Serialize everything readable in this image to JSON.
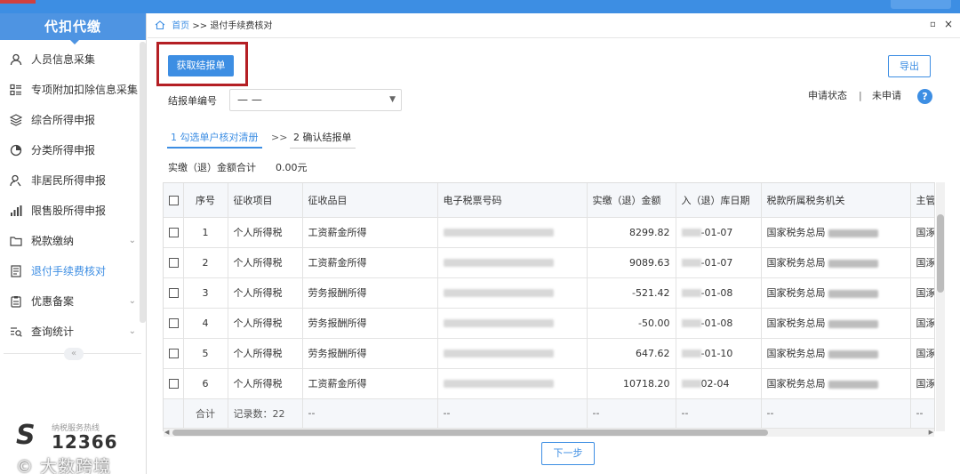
{
  "topbar": {
    "title": ""
  },
  "sidebar": {
    "title": "代扣代缴",
    "items": [
      {
        "label": "人员信息采集",
        "icon": "person-icon",
        "chevron": ""
      },
      {
        "label": "专项附加扣除信息采集",
        "icon": "list-icon",
        "chevron": ""
      },
      {
        "label": "综合所得申报",
        "icon": "layers-icon",
        "chevron": ""
      },
      {
        "label": "分类所得申报",
        "icon": "pie-icon",
        "chevron": ""
      },
      {
        "label": "非居民所得申报",
        "icon": "person-outline-icon",
        "chevron": ""
      },
      {
        "label": "限售股所得申报",
        "icon": "bar-chart-icon",
        "chevron": ""
      },
      {
        "label": "税款缴纳",
        "icon": "folder-icon",
        "chevron": "⌄"
      },
      {
        "label": "退付手续费核对",
        "icon": "document-icon",
        "chevron": "",
        "active": true
      },
      {
        "label": "优惠备案",
        "icon": "clipboard-icon",
        "chevron": "⌄"
      },
      {
        "label": "查询统计",
        "icon": "search-list-icon",
        "chevron": "⌄"
      }
    ],
    "collapse_glyph": "«",
    "hotline_label": "纳税服务热线",
    "hotline_number": "12366",
    "watermark": "© 大数跨境"
  },
  "breadcrumb": {
    "home": "首页",
    "sep": ">>",
    "current": "退付手续费核对"
  },
  "window_controls": {
    "restore": "▫",
    "close": "×"
  },
  "actions": {
    "fetch_label": "获取结报单",
    "export_label": "导出",
    "next_label": "下一步"
  },
  "filter": {
    "label": "结报单编号",
    "value": "— —"
  },
  "status": {
    "label": "申请状态",
    "sep": "|",
    "value": "未申请",
    "help": "?"
  },
  "steps": [
    {
      "label": "1 勾选单户核对清册",
      "active": true
    },
    {
      "label": "2 确认结报单",
      "active": false
    }
  ],
  "step_sep": ">>",
  "summary": {
    "label": "实缴（退）金额合计",
    "value": "0.00元"
  },
  "table": {
    "columns": [
      "序号",
      "征收项目",
      "征收品目",
      "电子税票号码",
      "实缴（退）金额",
      "入（退）库日期",
      "税款所属税务机关",
      "主管"
    ],
    "rows": [
      {
        "no": "1",
        "item": "个人所得税",
        "category": "工资薪金所得",
        "amount": "8299.82",
        "date": "-01-07",
        "office": "国家税务总局",
        "tail": "国涿"
      },
      {
        "no": "2",
        "item": "个人所得税",
        "category": "工资薪金所得",
        "amount": "9089.63",
        "date": "-01-07",
        "office": "国家税务总局",
        "tail": "国涿"
      },
      {
        "no": "3",
        "item": "个人所得税",
        "category": "劳务报酬所得",
        "amount": "-521.42",
        "date": "-01-08",
        "office": "国家税务总局",
        "tail": "国涿"
      },
      {
        "no": "4",
        "item": "个人所得税",
        "category": "劳务报酬所得",
        "amount": "-50.00",
        "date": "-01-08",
        "office": "国家税务总局",
        "tail": "国涿"
      },
      {
        "no": "5",
        "item": "个人所得税",
        "category": "劳务报酬所得",
        "amount": "647.62",
        "date": "-01-10",
        "office": "国家税务总局",
        "tail": "国涿"
      },
      {
        "no": "6",
        "item": "个人所得税",
        "category": "工资薪金所得",
        "amount": "10718.20",
        "date": "02-04",
        "office": "国家税务总局",
        "tail": "国涿"
      }
    ],
    "footer": {
      "label": "合计",
      "count": "记录数：22",
      "dash": "--"
    }
  }
}
